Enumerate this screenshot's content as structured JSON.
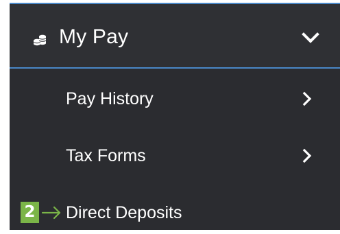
{
  "menu": {
    "section_title": "My Pay",
    "section_icon": "coins-stack-icon",
    "expanded_icon": "chevron-down-icon",
    "items": [
      {
        "label": "Pay History",
        "icon": "chevron-right-icon"
      },
      {
        "label": "Tax Forms",
        "icon": "chevron-right-icon"
      },
      {
        "label": "Direct Deposits"
      }
    ]
  },
  "annotation": {
    "step_number": "2",
    "arrow_icon": "right-arrow-icon"
  },
  "colors": {
    "menu_background": "#2e2f33",
    "accent_line": "#4a88c8",
    "text": "#ffffff",
    "step_badge": "#7bb548",
    "step_arrow": "#7bb548"
  }
}
